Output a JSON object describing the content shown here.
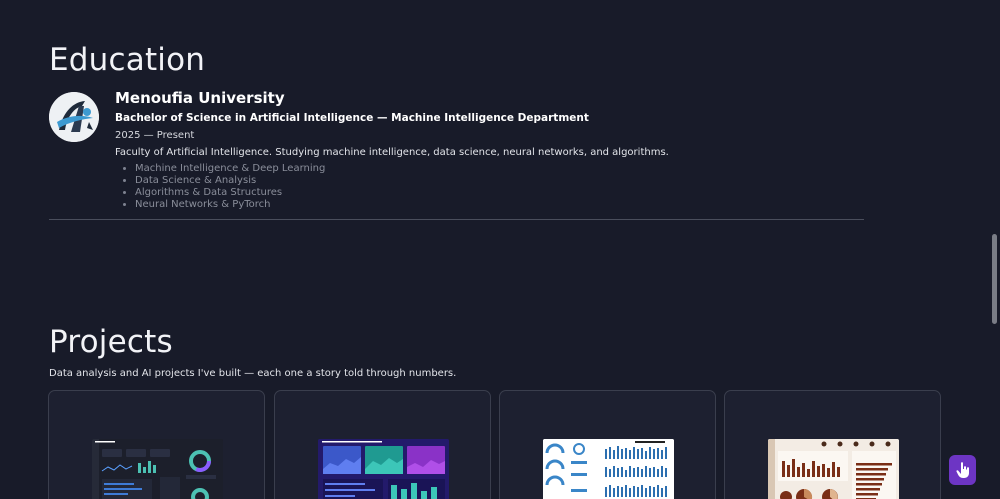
{
  "education": {
    "title": "Education",
    "entry": {
      "university": "Menoufia University",
      "degree": "Bachelor of Science in Artificial Intelligence — Machine Intelligence Department",
      "dates": "2025 — Present",
      "description": "Faculty of Artificial Intelligence. Studying machine intelligence, data science, neural networks, and algorithms.",
      "courses": [
        "Machine Intelligence & Deep Learning",
        "Data Science & Analysis",
        "Algorithms & Data Structures",
        "Neural Networks & PyTorch"
      ]
    }
  },
  "projects": {
    "title": "Projects",
    "subtitle": "Data analysis and AI projects I've built — each one a story told through numbers.",
    "cards": [
      {
        "thumb_title": "Sales And Enterprises Analysis Dashboard",
        "theme": "#1c1f2b"
      },
      {
        "thumb_title": "Revenue And Gross Margin Analysis",
        "theme": "#2a1f7a"
      },
      {
        "thumb_title": "FHBA Dashboard",
        "theme": "#ffffff"
      },
      {
        "thumb_title": "",
        "theme": "#f3ece4"
      }
    ]
  },
  "icons": {
    "fab": "pointer-hand-icon",
    "logo": "university-logo"
  },
  "colors": {
    "background": "#181b29",
    "card_border": "#3a3e4d",
    "fab": "#6d35c4"
  }
}
